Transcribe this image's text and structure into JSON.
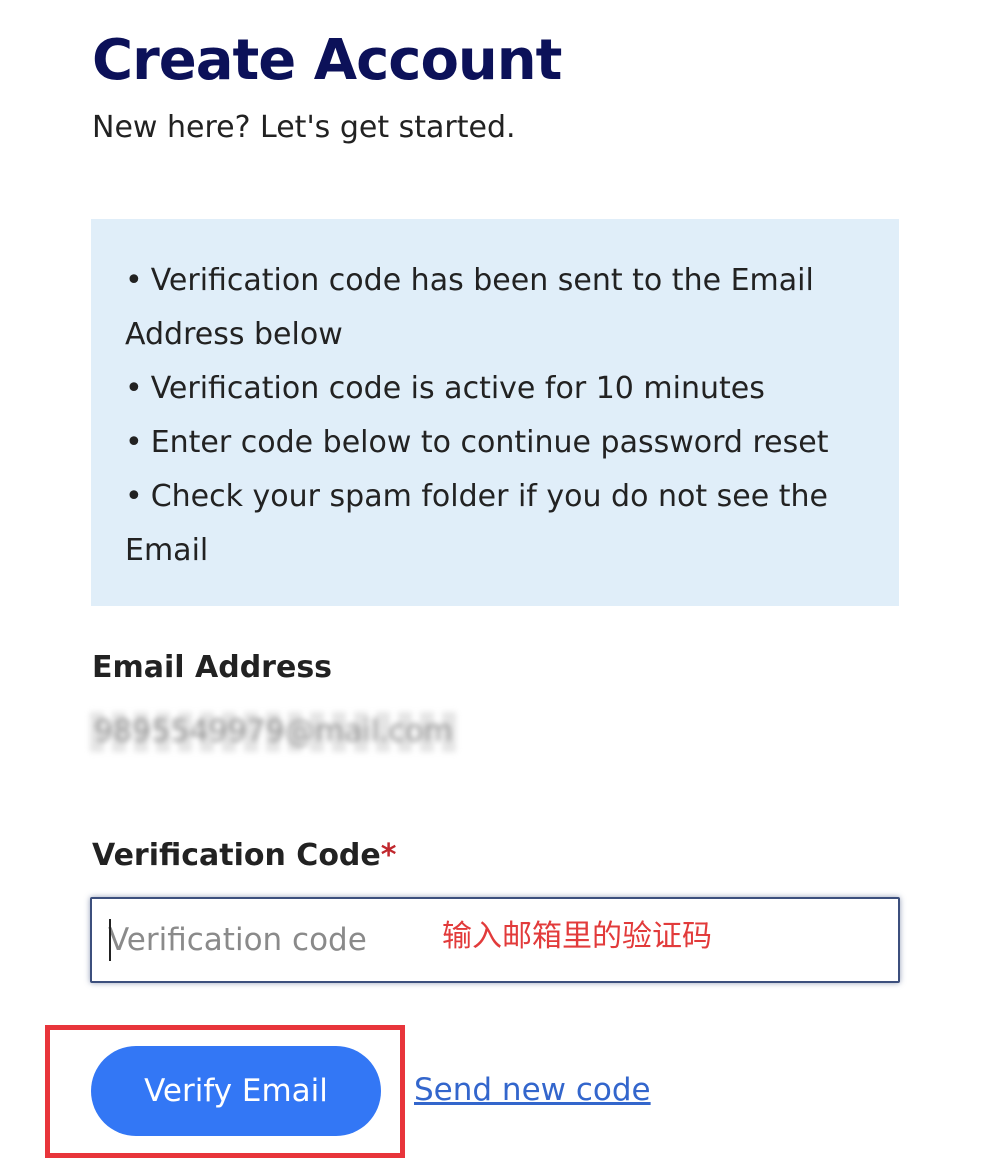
{
  "header": {
    "title": "Create Account",
    "subtitle": "New here? Let's get started."
  },
  "info": {
    "items": [
      "Verification code has been sent to the Email Address below",
      "Verification code is active for 10 minutes",
      "Enter code below to continue password reset",
      "Check your spam folder if you do not see the Email"
    ]
  },
  "email": {
    "label": "Email Address",
    "value": "9895549979@mail.com"
  },
  "code": {
    "label": "Verification Code",
    "required_mark": "*",
    "placeholder": "Verification code",
    "annotation": "输入邮箱里的验证码"
  },
  "actions": {
    "verify_label": "Verify Email",
    "resend_label": "Send new code"
  },
  "colors": {
    "title": "#0c1159",
    "info_bg": "#e0eef9",
    "primary_button": "#3377f5",
    "link": "#3366cc",
    "annotation": "#e23b3b",
    "required": "#c0272d"
  }
}
